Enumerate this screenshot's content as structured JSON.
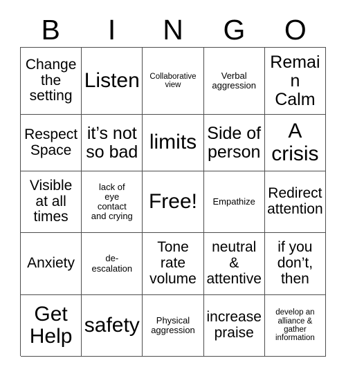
{
  "card": {
    "header_letters": [
      "B",
      "I",
      "N",
      "G",
      "O"
    ],
    "rows": [
      [
        {
          "text": "Change\nthe\nsetting",
          "size": "md",
          "free": false
        },
        {
          "text": "Listen",
          "size": "xl",
          "free": false
        },
        {
          "text": "Collaborative\nview",
          "size": "xxs",
          "free": false
        },
        {
          "text": "Verbal\naggression",
          "size": "xs",
          "free": false
        },
        {
          "text": "Remain\nCalm",
          "size": "lg",
          "free": false
        }
      ],
      [
        {
          "text": "Respect\nSpace",
          "size": "md",
          "free": false
        },
        {
          "text": "it’s not\nso bad",
          "size": "lg",
          "free": false
        },
        {
          "text": "limits",
          "size": "xl",
          "free": false
        },
        {
          "text": "Side of\nperson",
          "size": "lg",
          "free": false
        },
        {
          "text": "A\ncrisis",
          "size": "xl",
          "free": false
        }
      ],
      [
        {
          "text": "Visible\nat all\ntimes",
          "size": "md",
          "free": false
        },
        {
          "text": "lack of\neye\ncontact\nand crying",
          "size": "xs",
          "free": false
        },
        {
          "text": "Free!",
          "size": "xl",
          "free": true
        },
        {
          "text": "Empathize",
          "size": "xs",
          "free": false
        },
        {
          "text": "Redirect\nattention",
          "size": "md",
          "free": false
        }
      ],
      [
        {
          "text": "Anxiety",
          "size": "md",
          "free": false
        },
        {
          "text": "de-\nescalation",
          "size": "xs",
          "free": false
        },
        {
          "text": "Tone\nrate\nvolume",
          "size": "md",
          "free": false
        },
        {
          "text": "neutral\n&\nattentive",
          "size": "md",
          "free": false
        },
        {
          "text": "if you\ndon’t,\nthen",
          "size": "md",
          "free": false
        }
      ],
      [
        {
          "text": "Get\nHelp",
          "size": "xl",
          "free": false
        },
        {
          "text": "safety",
          "size": "xl",
          "free": false
        },
        {
          "text": "Physical\naggression",
          "size": "xs",
          "free": false
        },
        {
          "text": "increase\npraise",
          "size": "md",
          "free": false
        },
        {
          "text": "develop an\nalliance &\ngather\ninformation",
          "size": "xxs",
          "free": false
        }
      ]
    ]
  },
  "colors": {
    "background": "#ffffff",
    "text": "#000000",
    "grid_line": "#4d4d4d"
  }
}
